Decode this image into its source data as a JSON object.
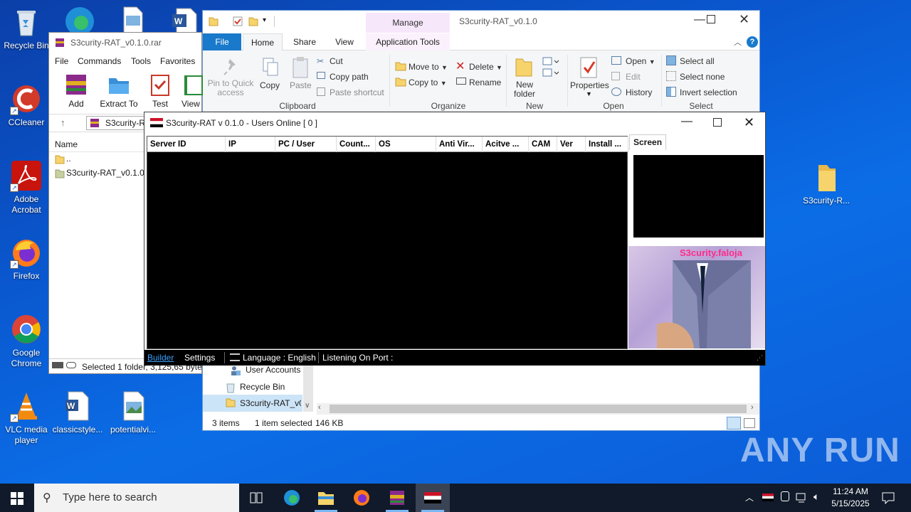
{
  "desktop": {
    "icons": [
      {
        "label": "Recycle Bin",
        "icon": "recycle-bin-icon"
      },
      {
        "label": "CCleaner",
        "icon": "ccleaner-icon"
      },
      {
        "label": "Adobe Acrobat",
        "icon": "acrobat-icon"
      },
      {
        "label": "Firefox",
        "icon": "firefox-icon"
      },
      {
        "label": "Google Chrome",
        "icon": "chrome-icon"
      },
      {
        "label": "VLC media player",
        "icon": "vlc-icon"
      },
      {
        "label": "classicstyle...",
        "icon": "word-doc-icon"
      },
      {
        "label": "potentialvi...",
        "icon": "image-file-icon"
      },
      {
        "label": "S3curity-R...",
        "icon": "folder-icon"
      }
    ]
  },
  "explorer": {
    "title": "S3curity-RAT_v0.1.0",
    "context_tab_header": "Manage",
    "tabs": [
      "File",
      "Home",
      "Share",
      "View",
      "Application Tools"
    ],
    "clipboard": {
      "pin": "Pin to Quick access",
      "copy": "Copy",
      "paste": "Paste",
      "cut": "Cut",
      "copy_path": "Copy path",
      "paste_shortcut": "Paste shortcut",
      "group": "Clipboard"
    },
    "organize": {
      "move_to": "Move to",
      "copy_to": "Copy to",
      "delete": "Delete",
      "rename": "Rename",
      "group": "Organize"
    },
    "new": {
      "new_folder": "New folder",
      "group": "New"
    },
    "open": {
      "properties": "Properties",
      "open": "Open",
      "edit": "Edit",
      "history": "History",
      "group": "Open"
    },
    "select": {
      "select_all": "Select all",
      "select_none": "Select none",
      "invert": "Invert selection",
      "group": "Select"
    },
    "nav": [
      "User Accounts",
      "Recycle Bin",
      "S3curity-RAT_v0..."
    ],
    "status": {
      "items": "3 items",
      "selected": "1 item selected",
      "size": "146 KB"
    }
  },
  "winrar": {
    "title": "S3curity-RAT_v0.1.0.rar",
    "menu": [
      "File",
      "Commands",
      "Tools",
      "Favorites"
    ],
    "toolbar": [
      "Add",
      "Extract To",
      "Test",
      "View"
    ],
    "path": "S3curity-R",
    "column_name": "Name",
    "rows": [
      "..",
      "S3curity-RAT_v0.1.0"
    ],
    "status": "Selected 1 folder, 3,125,65 byte"
  },
  "rat": {
    "title": "S3curity-RAT v 0.1.0 - Users Online [ 0 ]",
    "columns": [
      "Server ID",
      "IP",
      "PC / User",
      "Count...",
      "OS",
      "Anti Vir...",
      "Acitve ...",
      "CAM",
      "Ver",
      "Install ..."
    ],
    "screen_tab": "Screen",
    "banner_text": "S3curity.faloja",
    "status": {
      "builder": "Builder",
      "settings": "Settings",
      "language": "Language : English",
      "port": "Listening On Port :"
    }
  },
  "taskbar": {
    "search_placeholder": "Type here to search",
    "time": "11:24 AM",
    "date": "5/15/2025"
  },
  "watermark": "ANY RUN",
  "colors": {
    "accent": "#0078d7",
    "desktop": "#0a58d0",
    "taskbar": "#101a2a"
  }
}
